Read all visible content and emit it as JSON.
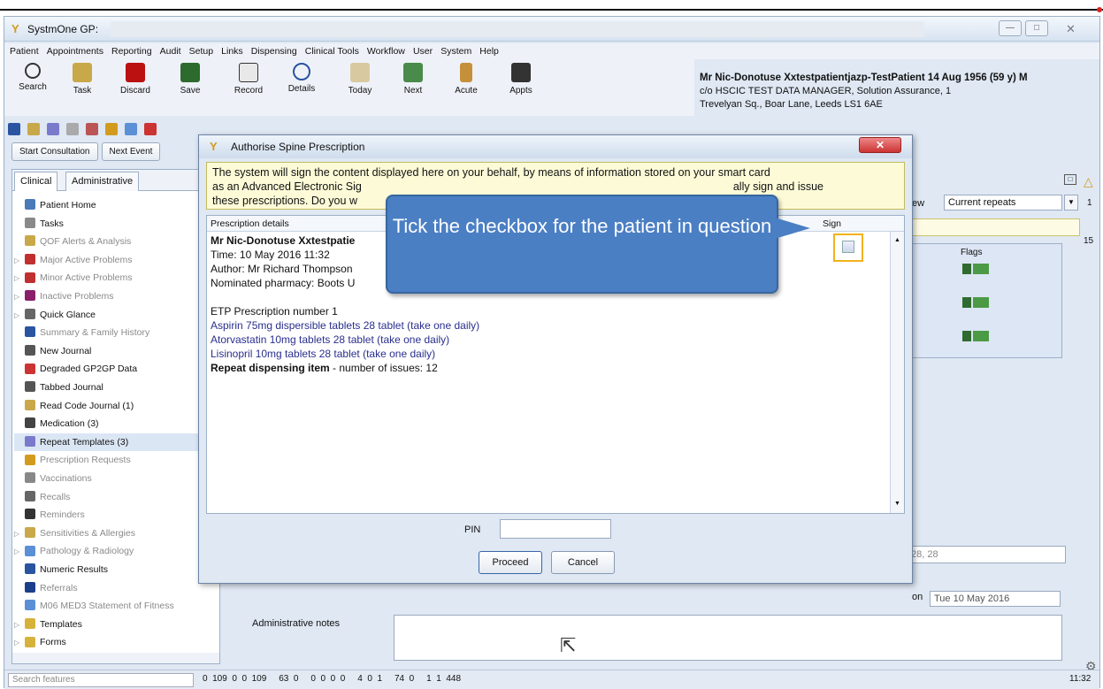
{
  "window": {
    "title": "SystmOne GP:",
    "icon": "systmone-y-icon"
  },
  "menu": [
    "Patient",
    "Appointments",
    "Reporting",
    "Audit",
    "Setup",
    "Links",
    "Dispensing",
    "Clinical Tools",
    "Workflow",
    "User",
    "System",
    "Help"
  ],
  "toolbar": [
    "Search",
    "Task",
    "Discard",
    "Save",
    "Record",
    "Details",
    "Today",
    "Next",
    "Acute",
    "Appts"
  ],
  "patient": {
    "name": "Mr Nic-Donotuse Xxtestpatientjazp-TestPatient 14 Aug 1956 (59 y) M",
    "address1": "c/o HSCIC TEST DATA MANAGER, Solution Assurance, 1",
    "address2": "Trevelyan Sq., Boar Lane, Leeds LS1 6AE"
  },
  "buttons": {
    "start_consultation": "Start Consultation",
    "next_event": "Next Event"
  },
  "tabs": {
    "clinical": "Clinical",
    "administrative": "Administrative"
  },
  "nav": [
    {
      "label": "Patient Home",
      "icon": "patient-home-icon"
    },
    {
      "label": "Tasks",
      "icon": "tasks-icon"
    },
    {
      "label": "QOF Alerts & Analysis",
      "icon": "qof-icon"
    },
    {
      "label": "Major Active Problems",
      "icon": "problems-icon"
    },
    {
      "label": "Minor Active Problems",
      "icon": "problems-icon"
    },
    {
      "label": "Inactive Problems",
      "icon": "inactive-problems-icon"
    },
    {
      "label": "Quick Glance",
      "icon": "eye-icon"
    },
    {
      "label": "Summary & Family History",
      "icon": "summary-icon"
    },
    {
      "label": "New Journal",
      "icon": "journal-icon"
    },
    {
      "label": "Degraded GP2GP Data",
      "icon": "degraded-data-icon"
    },
    {
      "label": "Tabbed Journal",
      "icon": "journal-icon"
    },
    {
      "label": "Read Code Journal (1)",
      "icon": "read-code-icon"
    },
    {
      "label": "Medication (3)",
      "icon": "medication-icon"
    },
    {
      "label": "Repeat Templates (3)",
      "icon": "repeat-templates-icon"
    },
    {
      "label": "Prescription Requests",
      "icon": "prescription-requests-icon"
    },
    {
      "label": "Vaccinations",
      "icon": "syringe-icon"
    },
    {
      "label": "Recalls",
      "icon": "recalls-icon"
    },
    {
      "label": "Reminders",
      "icon": "reminders-icon"
    },
    {
      "label": "Sensitivities & Allergies",
      "icon": "allergies-icon"
    },
    {
      "label": "Pathology & Radiology",
      "icon": "pathology-icon"
    },
    {
      "label": "Numeric Results",
      "icon": "numeric-results-icon"
    },
    {
      "label": "Referrals",
      "icon": "arrow-right-icon"
    },
    {
      "label": "M06 MED3 Statement of Fitness",
      "icon": "statement-icon"
    },
    {
      "label": "Templates",
      "icon": "folder-icon"
    },
    {
      "label": "Forms",
      "icon": "folder-icon"
    }
  ],
  "status": {
    "search_placeholder": "Search features",
    "counters": [
      "0",
      "109",
      "0",
      "0",
      "109",
      "63",
      "0",
      "0",
      "0",
      "0",
      "0",
      "4",
      "0",
      "1",
      "74",
      "0",
      "1",
      "1",
      "448"
    ],
    "time": "11:32"
  },
  "right": {
    "view_label": "ew",
    "view_value": "Current repeats",
    "flags_label": "Flags",
    "side_numbers": [
      "1",
      "15"
    ],
    "lower_value": "28, 28",
    "date_label": "on",
    "date_value": "Tue 10 May 2016",
    "admin_notes_label": "Administrative notes"
  },
  "dialog": {
    "title": "Authorise Spine Prescription",
    "notice_line1": "The system will sign the content displayed here on your behalf, by means of information stored on your smart card",
    "notice_line2": "as an Advanced Electronic Sig",
    "notice_line2b": "ally sign and issue",
    "notice_line3": "these prescriptions. Do you w",
    "col_prescription": "Prescription details",
    "col_sign": "Sign",
    "patient_line": "Mr Nic-Donotuse Xxtestpatie",
    "time_line": "Time: 10 May 2016 11:32",
    "author_line": "Author: Mr Richard Thompson",
    "pharmacy_line": "Nominated pharmacy: Boots U",
    "etp_line": "ETP Prescription number 1",
    "drugs": [
      "Aspirin 75mg dispersible tablets 28 tablet (take one daily)",
      "Atorvastatin 10mg tablets 28 tablet (take one daily)",
      "Lisinopril 10mg tablets 28 tablet (take one daily)"
    ],
    "repeat_bold": "Repeat dispensing item",
    "repeat_rest": " - number of issues: 12",
    "pin_label": "PIN",
    "proceed": "Proceed",
    "cancel": "Cancel"
  },
  "callout": {
    "text": "Tick the checkbox for the patient in question"
  },
  "colors": {
    "callout": "#4b7fc4",
    "highlight": "#f2b21c",
    "notice_bg": "#fdfbd7",
    "drug_text": "#2a2f8e"
  }
}
